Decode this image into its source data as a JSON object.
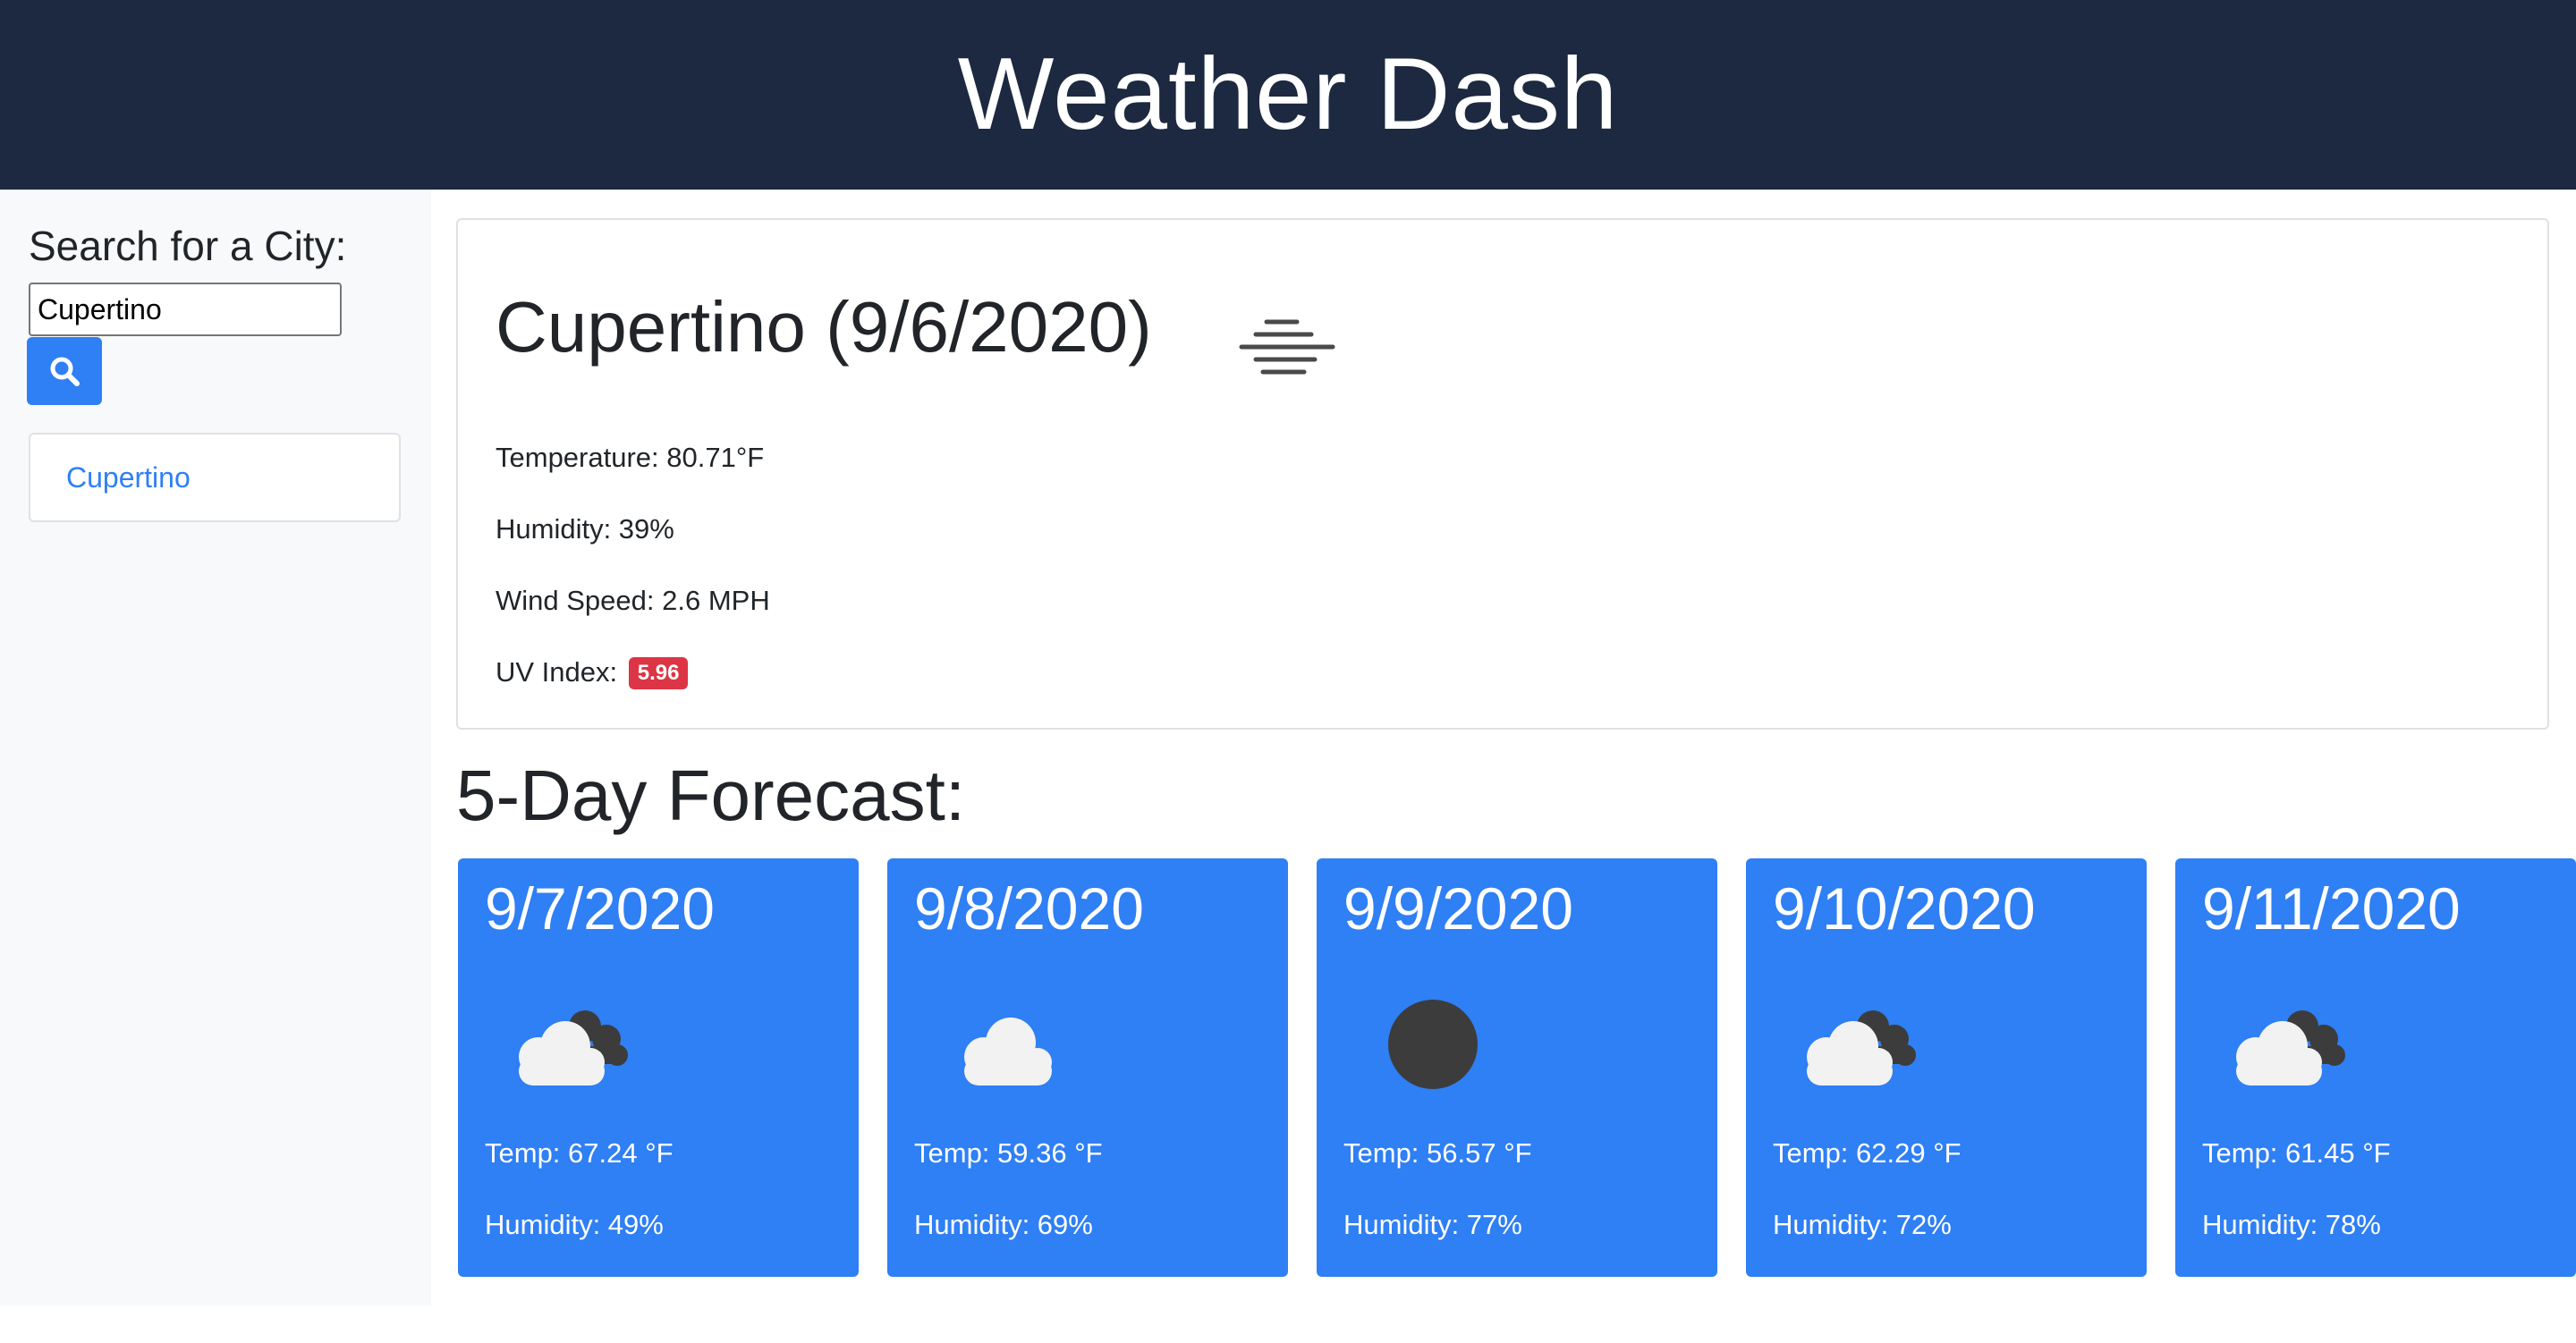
{
  "header": {
    "title": "Weather Dash"
  },
  "sidebar": {
    "heading": "Search for a City:",
    "search_value": "Cupertino",
    "search_icon": "search-icon",
    "history": [
      "Cupertino"
    ]
  },
  "current": {
    "title": "Cupertino (9/6/2020)",
    "icon": "haze-icon",
    "temperature": "Temperature: 80.71°F",
    "humidity": "Humidity: 39%",
    "wind": "Wind Speed: 2.6 MPH",
    "uv_label": "UV Index:",
    "uv_value": "5.96",
    "uv_color": "#dc3545"
  },
  "forecast": {
    "title": "5-Day Forecast:",
    "days": [
      {
        "date": "9/7/2020",
        "icon": "broken-clouds-icon",
        "temp": "Temp: 67.24 °F",
        "humidity": "Humidity: 49%"
      },
      {
        "date": "9/8/2020",
        "icon": "cloud-icon",
        "temp": "Temp: 59.36 °F",
        "humidity": "Humidity: 69%"
      },
      {
        "date": "9/9/2020",
        "icon": "dark-sun-icon",
        "temp": "Temp: 56.57 °F",
        "humidity": "Humidity: 77%"
      },
      {
        "date": "9/10/2020",
        "icon": "broken-clouds-icon",
        "temp": "Temp: 62.29 °F",
        "humidity": "Humidity: 72%"
      },
      {
        "date": "9/11/2020",
        "icon": "broken-clouds-icon",
        "temp": "Temp: 61.45 °F",
        "humidity": "Humidity: 78%"
      }
    ]
  },
  "colors": {
    "header_bg": "#1c2940",
    "accent": "#2f7ff5",
    "sidebar_bg": "#f8f9fa",
    "badge_danger": "#dc3545"
  }
}
